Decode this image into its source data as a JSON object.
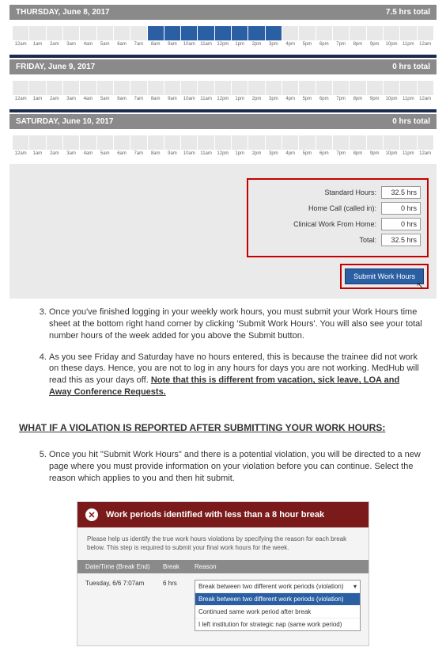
{
  "days": {
    "d1": {
      "label": "THURSDAY, June 8, 2017",
      "total": "7.5 hrs total",
      "fillStart": 8,
      "fillEnd": 15
    },
    "d2": {
      "label": "FRIDAY, June 9, 2017",
      "total": "0 hrs total",
      "fillStart": -1,
      "fillEnd": -1
    },
    "d3": {
      "label": "SATURDAY, June 10, 2017",
      "total": "0 hrs total",
      "fillStart": -1,
      "fillEnd": -1
    }
  },
  "hourLabels": [
    "12am",
    "1am",
    "2am",
    "3am",
    "4am",
    "5am",
    "6am",
    "7am",
    "8am",
    "9am",
    "10am",
    "11am",
    "12pm",
    "1pm",
    "2pm",
    "3pm",
    "4pm",
    "5pm",
    "6pm",
    "7pm",
    "8pm",
    "9pm",
    "10pm",
    "11pm",
    "12am"
  ],
  "summary": {
    "standard": {
      "label": "Standard Hours:",
      "value": "32.5 hrs"
    },
    "homecall": {
      "label": "Home Call (called in):",
      "value": "0 hrs"
    },
    "clinical": {
      "label": "Clinical Work From Home:",
      "value": "0 hrs"
    },
    "total": {
      "label": "Total:",
      "value": "32.5 hrs"
    }
  },
  "submit": {
    "label": "Submit Work Hours"
  },
  "instructions": {
    "i3": "Once you've finished logging in your weekly work hours, you must submit your Work Hours time sheet at the bottom right hand corner by clicking 'Submit Work Hours'.  You will also see your total number hours of the week added for you above the Submit button.",
    "i4a": "As you see Friday and Saturday have no hours entered, this is because the trainee did not work on these days. Hence, you are not to log in any hours for days you are not working.  MedHub will read this as your days off.  ",
    "i4b": "Note that this is different from vacation, sick leave, LOA and Away Conference Requests.",
    "i5": "Once you hit \"Submit Work Hours\" and there is a potential violation, you will be directed to a new page where you must  provide information on your violation before you can continue. Select the reason which applies to you and then hit submit."
  },
  "sectionTitle": "WHAT IF A VIOLATION IS REPORTED AFTER SUBMITTING YOUR WORK HOURS:",
  "violation": {
    "title": "Work periods identified with less than a 8 hour break",
    "help": "Please help us identify the true work hours violations by specifying the reason for each break below. This step is required to submit your final work hours for the week.",
    "col1": "Date/Time (Break End)",
    "col2": "Break",
    "col3": "Reason",
    "row": {
      "date": "Tuesday, 6/6 7:07am",
      "break": "6 hrs"
    },
    "options": {
      "sel": "Break between two different work periods (violation)",
      "o1": "Break between two different work periods (violation)",
      "o2": "Continued same work period after break",
      "o3": "I left institution for strategic nap (same work period)"
    }
  }
}
